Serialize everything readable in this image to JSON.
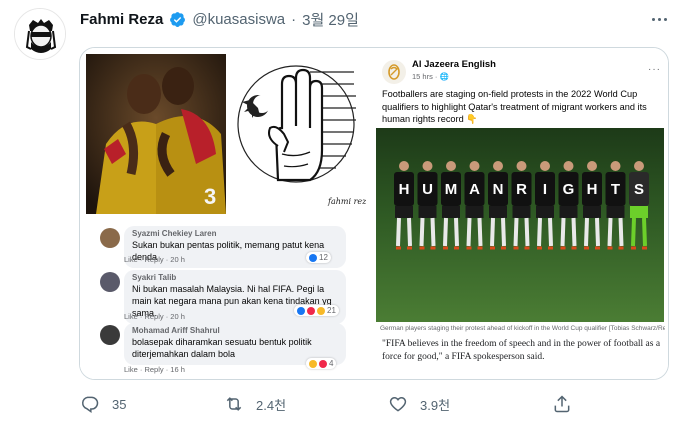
{
  "tweet": {
    "display_name": "Fahmi Reza",
    "handle": "@kuasasiswa",
    "separator": "·",
    "date": "3월 29일",
    "avatar_icon": "masked-face-avatar",
    "verified_icon": "verified-badge-icon",
    "more_icon": "more-options-icon"
  },
  "image_left": {
    "shirt_number": "3",
    "art_signature": "fahmi reza"
  },
  "comments": [
    {
      "author": "Syazmi Chekiey Laren",
      "text": "Sukan bukan pentas politik, memang patut kena denda",
      "like_label": "Like",
      "reply_label": "Reply",
      "time": "20 h",
      "reactions": "12"
    },
    {
      "author": "Syakri Talib",
      "text": "Ni bukan masalah Malaysia. Ni hal FIFA. Pegi la main kat negara mana pun akan kena tindakan yg sama.",
      "like_label": "Like",
      "reply_label": "Reply",
      "time": "20 h",
      "reactions": "21"
    },
    {
      "author": "Mohamad Ariff Shahrul",
      "text": "bolasepak diharamkan sesuatu bentuk politik diterjemahkan dalam bola",
      "like_label": "Like",
      "reply_label": "Reply",
      "time": "16 h",
      "reactions": "4"
    }
  ],
  "embedded_post": {
    "author": "Al Jazeera English",
    "meta": "15 hrs · 🌐",
    "more": "···",
    "text": "Footballers are staging on-field protests in the 2022 World Cup qualifiers to highlight Qatar's treatment of migrant workers and its human rights record 👇",
    "shirt_letters": [
      "H",
      "U",
      "M",
      "A",
      "N",
      "R",
      "I",
      "G",
      "H",
      "T",
      "S"
    ],
    "caption": "German players staging their protest ahead of kickoff in the World Cup qualifier [Tobias Schwarz/Reuters]",
    "quote": "\"FIFA believes in the freedom of speech and in the power of football as a force for good,\" a FIFA spokesperson said."
  },
  "actions": {
    "reply_count": "35",
    "retweet_count": "2.4천",
    "like_count": "3.9천",
    "reply_icon": "reply-icon",
    "retweet_icon": "retweet-icon",
    "like_icon": "heart-icon",
    "share_icon": "share-icon"
  },
  "colors": {
    "text_primary": "#0f1419",
    "text_secondary": "#536471",
    "verified": "#1d9bf0",
    "border": "#cfd9de",
    "pitch": "#3d6a2c"
  }
}
